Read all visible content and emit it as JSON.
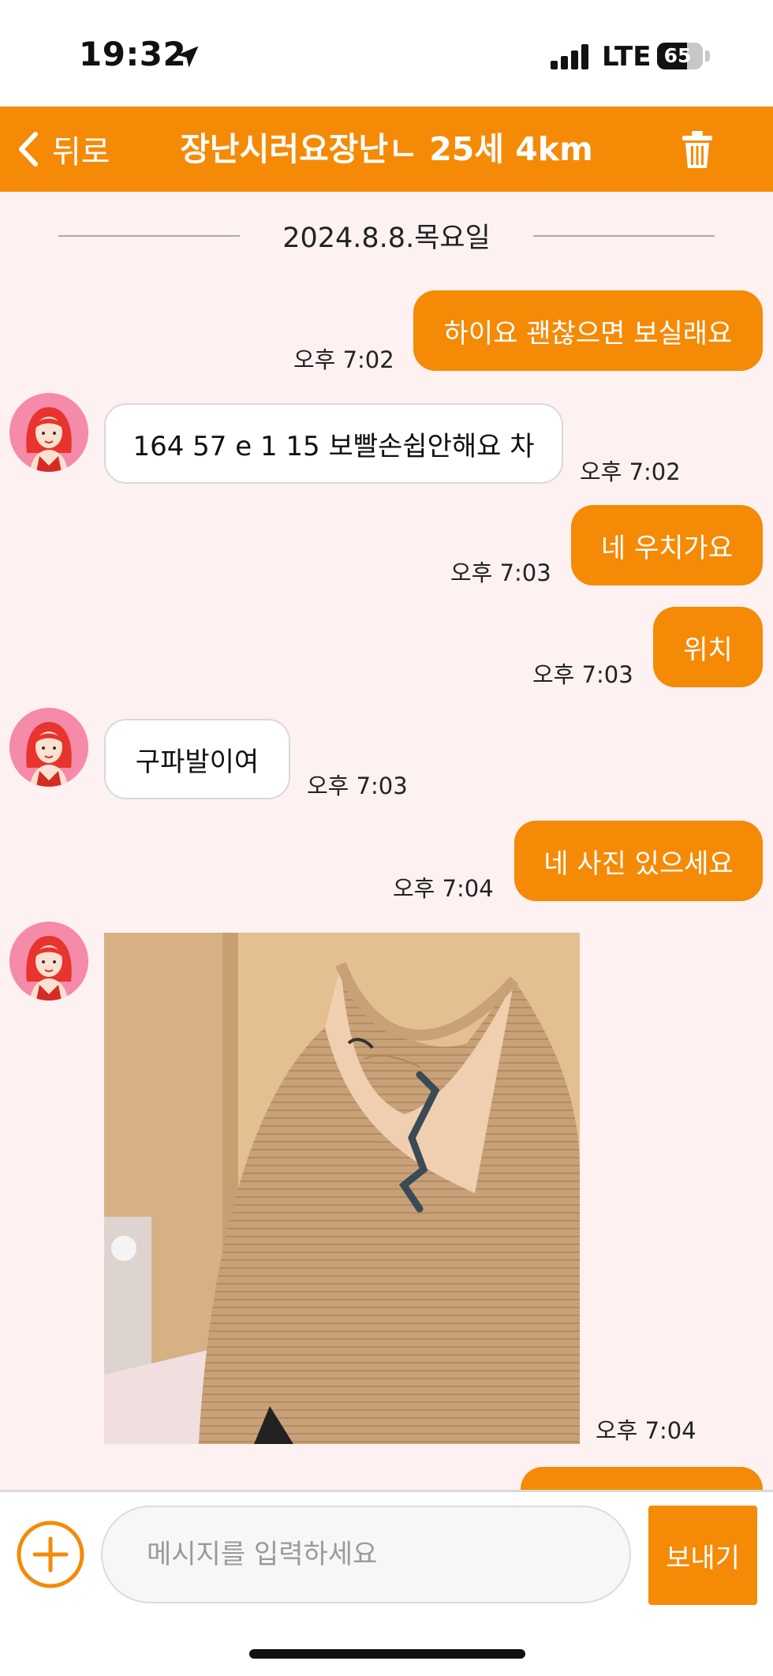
{
  "status_bar": {
    "time": "19:32",
    "network": "LTE",
    "battery": "65",
    "battery_level": 0.65
  },
  "header": {
    "back_label": "뒤로",
    "title": "장난시러요장난ㄴ 25세 4km"
  },
  "chat": {
    "date": "2024.8.8.목요일",
    "messages": [
      {
        "from": "me",
        "text": "하이요 괜찮으면 보실래요",
        "time": "오후 7:02"
      },
      {
        "from": "them",
        "text": "164 57 e 1 15 보빨손쉽안해요 차",
        "time": "오후 7:02"
      },
      {
        "from": "me",
        "text": "네 우치가요",
        "time": "오후 7:03"
      },
      {
        "from": "me",
        "text": "위치",
        "time": "오후 7:03"
      },
      {
        "from": "them",
        "text": "구파발이여",
        "time": "오후 7:03"
      },
      {
        "from": "me",
        "text": "네 사진 있으세요",
        "time": "오후 7:04"
      },
      {
        "from": "them",
        "type": "image",
        "time": "오후 7:04"
      }
    ]
  },
  "input": {
    "placeholder": "메시지를 입력하세요",
    "send_label": "보내기"
  },
  "colors": {
    "accent": "#f58a07",
    "chat_background": "#fdf1f1",
    "avatar_background": "#f58aa9"
  },
  "icons": {
    "back": "chevron-left-icon",
    "trash": "trash-icon",
    "add": "plus-circle-icon",
    "location": "location-arrow-icon"
  }
}
